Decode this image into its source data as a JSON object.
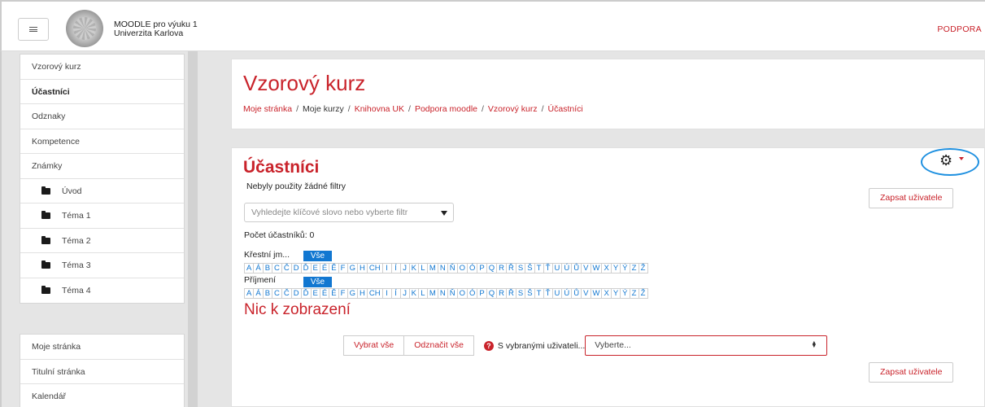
{
  "header": {
    "site_name_line1": "MOODLE pro výuku 1",
    "site_name_line2": "Univerzita Karlova",
    "support_link": "PODPORA"
  },
  "sidebar": {
    "items": [
      {
        "label": "Vzorový kurz",
        "active": false
      },
      {
        "label": "Účastníci",
        "active": true
      },
      {
        "label": "Odznaky",
        "active": false
      },
      {
        "label": "Kompetence",
        "active": false
      },
      {
        "label": "Známky",
        "active": false
      }
    ],
    "sections": [
      "Úvod",
      "Téma 1",
      "Téma 2",
      "Téma 3",
      "Téma 4"
    ],
    "lower_items": [
      "Moje stránka",
      "Titulní stránka",
      "Kalendář"
    ]
  },
  "page": {
    "title": "Vzorový kurz",
    "breadcrumb": [
      "Moje stránka",
      "Moje kurzy",
      "Knihovna UK",
      "Podpora moodle",
      "Vzorový kurz",
      "Účastníci"
    ]
  },
  "participants": {
    "title": "Účastníci",
    "no_filters": "Nebyly použity žádné filtry",
    "filter_placeholder": "Vyhledejte klíčové slovo nebo vyberte filtr",
    "enrol_button": "Zapsat uživatele",
    "count_label": "Počet účastníků: 0",
    "firstname_label": "Křestní jm...",
    "lastname_label": "Příjmení",
    "all_label": "Vše",
    "letters": [
      "A",
      "Á",
      "B",
      "C",
      "Č",
      "D",
      "Ď",
      "E",
      "É",
      "Ě",
      "F",
      "G",
      "H",
      "CH",
      "I",
      "Í",
      "J",
      "K",
      "L",
      "M",
      "N",
      "Ň",
      "O",
      "Ó",
      "P",
      "Q",
      "R",
      "Ř",
      "S",
      "Š",
      "T",
      "Ť",
      "U",
      "Ú",
      "Ů",
      "V",
      "W",
      "X",
      "Y",
      "Ý",
      "Z",
      "Ž"
    ],
    "nothing_to_display": "Nic k zobrazení",
    "select_all": "Vybrat vše",
    "deselect_all": "Odznačit vše",
    "with_selected": "S vybranými uživateli...",
    "with_selected_value": "Vyberte..."
  },
  "colors": {
    "accent": "#c9232b",
    "link_blue": "#1177d1",
    "highlight_circle": "#1e90e0"
  }
}
